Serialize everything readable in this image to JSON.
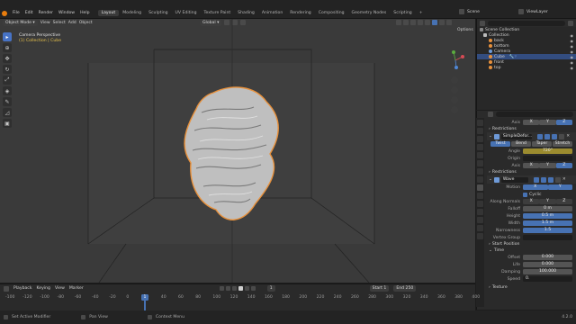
{
  "menus": [
    "File",
    "Edit",
    "Render",
    "Window",
    "Help"
  ],
  "workspaces": [
    "Layout",
    "Modeling",
    "Sculpting",
    "UV Editing",
    "Texture Paint",
    "Shading",
    "Animation",
    "Rendering",
    "Compositing",
    "Geometry Nodes",
    "Scripting"
  ],
  "active_workspace": "Layout",
  "scene": "Scene",
  "view_layer": "ViewLayer",
  "viewport": {
    "mode": "Object Mode",
    "menus": [
      "View",
      "Select",
      "Add",
      "Object"
    ],
    "orientation": "Global",
    "overlay_title": "Camera Perspective",
    "overlay_sub": "(1) Collection | Cube",
    "options": "Options"
  },
  "outliner": {
    "search_placeholder": "",
    "items": [
      {
        "label": "Scene Collection",
        "indent": 0
      },
      {
        "label": "Collection",
        "indent": 1
      },
      {
        "label": "back",
        "indent": 2
      },
      {
        "label": "bottom",
        "indent": 2
      },
      {
        "label": "Camera",
        "indent": 2
      },
      {
        "label": "Cube",
        "indent": 2,
        "selected": true
      },
      {
        "label": "front",
        "indent": 2
      },
      {
        "label": "top",
        "indent": 2
      }
    ]
  },
  "properties": {
    "axis_label": "Axis",
    "axis_values": [
      "X",
      "Y",
      "Z"
    ],
    "restrictions": "Restrictions",
    "modifier1": "SimpleDefor...",
    "deform_tabs": [
      "Twist",
      "Bend",
      "Taper",
      "Stretch"
    ],
    "angle_label": "Angle",
    "angle_value": "720°",
    "origin_label": "Origin",
    "axis2_label": "Axis",
    "axis2_values": [
      "X",
      "Y",
      "Z"
    ],
    "restrictions2": "Restrictions",
    "modifier2": "Wave",
    "motion_label": "Motion",
    "motion_values": [
      "X",
      "Y"
    ],
    "cyclic": "Cyclic",
    "along_normals": "Along Normals",
    "along_values": [
      "X",
      "Y",
      "Z"
    ],
    "falloff_label": "Falloff",
    "falloff_value": "0 m",
    "height_label": "Height",
    "height_value": "0.5 m",
    "width_label": "Width",
    "width_value": "1.5 m",
    "narrowness_label": "Narrowness",
    "narrowness_value": "1.5",
    "vertex_group": "Vertex Group",
    "start_position": "Start Position",
    "time": "Time",
    "offset_label": "Offset",
    "offset_value": "0.000",
    "life_label": "Life",
    "life_value": "0.000",
    "damping_label": "Damping",
    "damping_value": "100.000",
    "speed_label": "Speed",
    "speed_value": "0.",
    "texture": "Texture"
  },
  "timeline": {
    "menus": [
      "Playback",
      "Keying",
      "View",
      "Marker"
    ],
    "current_frame": "1",
    "start_label": "Start",
    "start_value": "1",
    "end_label": "End",
    "end_value": "250",
    "ticks": [
      "-100",
      "-120",
      "-100",
      "-80",
      "-60",
      "-40",
      "-20",
      "0",
      "20",
      "40",
      "60",
      "80",
      "100",
      "120",
      "140",
      "160",
      "180",
      "200",
      "220",
      "240",
      "260",
      "280",
      "300",
      "320",
      "340",
      "360",
      "380",
      "400"
    ]
  },
  "status": {
    "left": "Set Active Modifier",
    "middle": "Pan View",
    "right": "Context Menu",
    "version": "4.2.0"
  },
  "colors": {
    "accent": "#4772b3",
    "selection_outline": "#e8913c",
    "active_tab": "#4773c6"
  }
}
